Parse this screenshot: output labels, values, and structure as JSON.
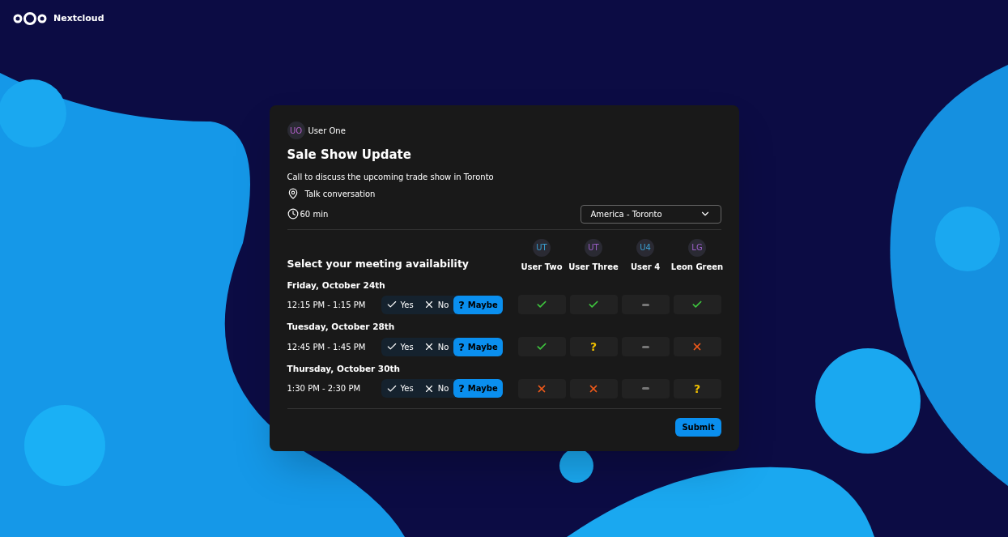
{
  "brand": {
    "name": "Nextcloud"
  },
  "organizer": {
    "initials": "UO",
    "name": "User One",
    "color": "#b05fc8"
  },
  "title": "Sale Show Update",
  "description": "Call to discuss the upcoming trade show in Toronto",
  "location": "Talk conversation",
  "duration": "60 min",
  "timezone": "America - Toronto",
  "heading": "Select your meeting availability",
  "participants": [
    {
      "initials": "UT",
      "name": "User Two",
      "color": "#3a9fd0"
    },
    {
      "initials": "UT",
      "name": "User Three",
      "color": "#9a5fc8"
    },
    {
      "initials": "U4",
      "name": "User 4",
      "color": "#3a9fd0"
    },
    {
      "initials": "LG",
      "name": "Leon Green",
      "color": "#9a5fc8"
    }
  ],
  "slots": [
    {
      "date": "Friday, October 24th",
      "time": "12:15 PM - 1:15 PM",
      "options": [
        {
          "kind": "yes",
          "label": "Yes",
          "selected": false
        },
        {
          "kind": "no",
          "label": "No",
          "selected": false
        },
        {
          "kind": "maybe",
          "icon": "?",
          "label": "Maybe",
          "selected": true
        }
      ],
      "answers": [
        {
          "kind": "yes"
        },
        {
          "kind": "yes"
        },
        {
          "kind": "none"
        },
        {
          "kind": "yes"
        }
      ]
    },
    {
      "date": "Tuesday, October 28th",
      "time": "12:45 PM - 1:45 PM",
      "options": [
        {
          "kind": "yes",
          "label": "Yes",
          "selected": false
        },
        {
          "kind": "no",
          "label": "No",
          "selected": false
        },
        {
          "kind": "maybe",
          "icon": "?",
          "label": "Maybe",
          "selected": true
        }
      ],
      "answers": [
        {
          "kind": "yes"
        },
        {
          "kind": "maybe",
          "icon": "?"
        },
        {
          "kind": "none"
        },
        {
          "kind": "no"
        }
      ]
    },
    {
      "date": "Thursday, October 30th",
      "time": "1:30 PM - 2:30 PM",
      "options": [
        {
          "kind": "yes",
          "label": "Yes",
          "selected": false
        },
        {
          "kind": "no",
          "label": "No",
          "selected": false
        },
        {
          "kind": "maybe",
          "icon": "?",
          "label": "Maybe",
          "selected": true
        }
      ],
      "answers": [
        {
          "kind": "no"
        },
        {
          "kind": "no"
        },
        {
          "kind": "none"
        },
        {
          "kind": "maybe",
          "icon": "?"
        }
      ]
    }
  ],
  "submit": "Submit"
}
